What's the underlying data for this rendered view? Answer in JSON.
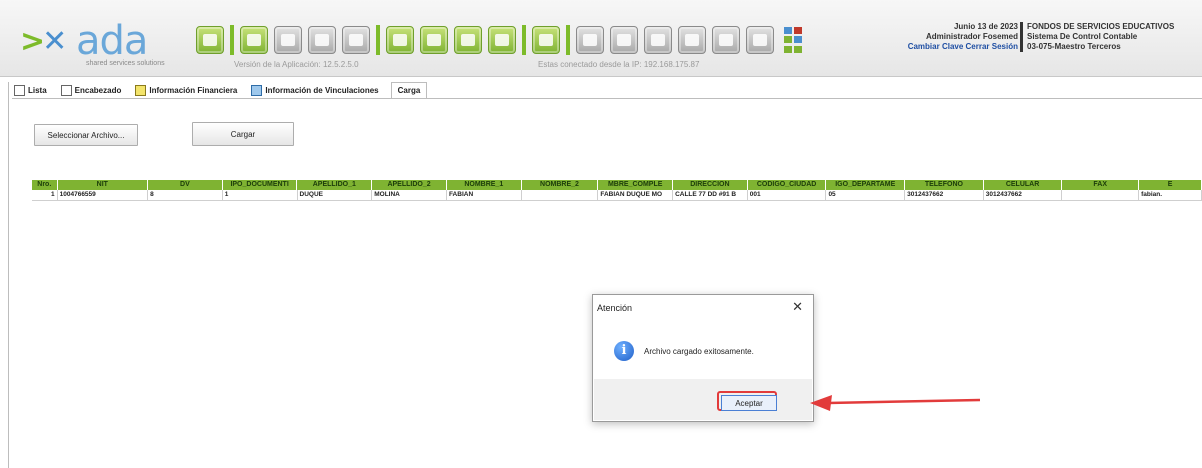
{
  "app": {
    "logo_text": "ada",
    "tagline": "shared services solutions",
    "version": "Versión de la Aplicación: 12.5.2.5.0",
    "ip_info": "Estas conectado desde la IP: 192.168.175.87"
  },
  "user": {
    "date": "Junio 13 de 2023",
    "role": "Administrador Fosemed",
    "change_password": "Cambiar Clave",
    "logout": "Cerrar Sesión"
  },
  "org": {
    "line1": "FONDOS DE SERVICIOS EDUCATIVOS",
    "line2": "Sistema De Control Contable",
    "line3": "03-075-Maestro Terceros"
  },
  "tabs": [
    {
      "label": "Lista"
    },
    {
      "label": "Encabezado"
    },
    {
      "label": "Información Financiera"
    },
    {
      "label": "Información de Vinculaciones"
    },
    {
      "label": "Carga"
    }
  ],
  "actions": {
    "select_file": "Seleccionar Archivo...",
    "upload": "Cargar"
  },
  "grid": {
    "columns": [
      "Nro.",
      "NIT",
      "DV",
      "IPO_DOCUMENTI",
      "APELLIDO_1",
      "APELLIDO_2",
      "NOMBRE_1",
      "NOMBRE_2",
      "MBRE_COMPLE",
      "DIRECCION",
      "CODIGO_CIUDAD",
      "IGO_DEPARTAME",
      "TELEFONO",
      "CELULAR",
      "FAX",
      "E"
    ],
    "rows": [
      [
        "1",
        "1004766559",
        "8",
        "1",
        "DUQUE",
        "MOLINA",
        "FABIAN",
        "",
        "FABIAN DUQUE MO",
        "CALLE 77 DD #91 B",
        "001",
        "05",
        "3012437662",
        "3012437662",
        "",
        "fabian."
      ]
    ]
  },
  "dialog": {
    "title": "Atención",
    "message": "Archivo cargado exitosamente.",
    "ok_label": "Aceptar",
    "close_glyph": "✕",
    "info_glyph": "i"
  },
  "colors": {
    "accent_green": "#7fb332",
    "highlight_red": "#e23b3b"
  }
}
